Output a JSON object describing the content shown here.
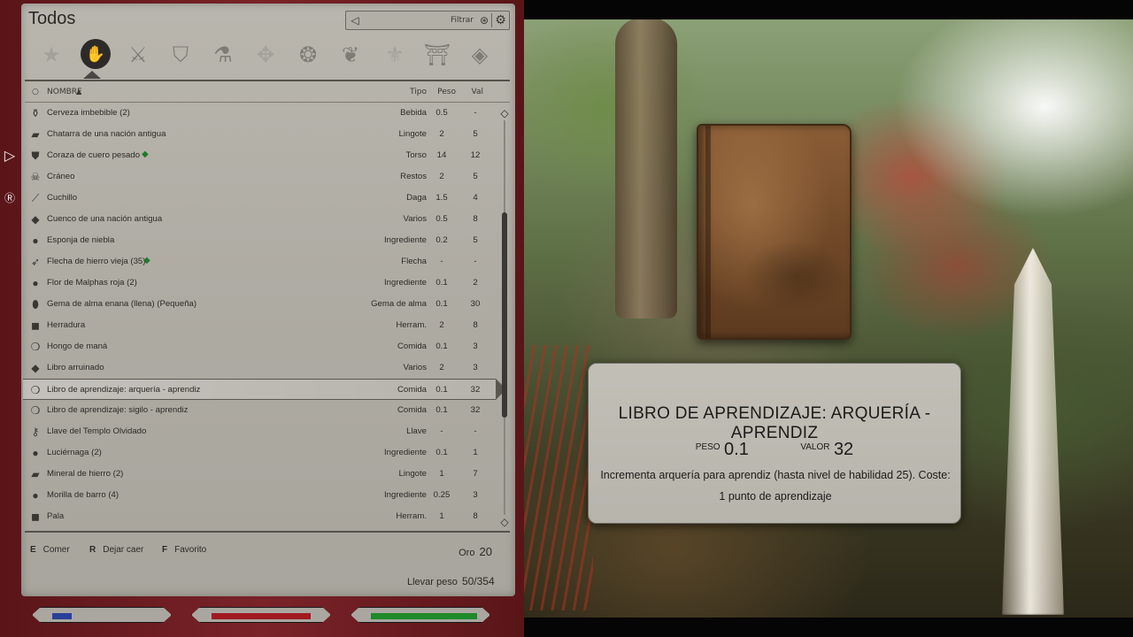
{
  "category": {
    "title": "Todos",
    "icons": [
      "star-icon",
      "all-items-icon",
      "weapons-icon",
      "armor-icon",
      "potions-icon",
      "scrolls-icon",
      "food-icon",
      "ingredients-icon",
      "books-icon",
      "keys-icon",
      "misc-icon"
    ],
    "active_index": 1
  },
  "filter": {
    "label": "Filtrar"
  },
  "columns": {
    "name": "NOMBRE",
    "type": "Tipo",
    "weight": "Peso",
    "value": "Val"
  },
  "items": [
    {
      "icon": "potion-icon",
      "name": "Cerveza imbebible (2)",
      "type": "Bebida",
      "weight": "0.5",
      "value": "-"
    },
    {
      "icon": "ingot-icon",
      "name": "Chatarra de una nación antigua",
      "type": "Lingote",
      "weight": "2",
      "value": "5"
    },
    {
      "icon": "armor-icon",
      "name": "Coraza de cuero pesado",
      "type": "Torso",
      "weight": "14",
      "value": "12",
      "favorite": true
    },
    {
      "icon": "skull-icon",
      "name": "Cráneo",
      "type": "Restos",
      "weight": "2",
      "value": "5"
    },
    {
      "icon": "dagger-icon",
      "name": "Cuchillo",
      "type": "Daga",
      "weight": "1.5",
      "value": "4"
    },
    {
      "icon": "misc-icon",
      "name": "Cuenco de una nación antigua",
      "type": "Varios",
      "weight": "0.5",
      "value": "8"
    },
    {
      "icon": "ingredient-icon",
      "name": "Esponja de niebla",
      "type": "Ingrediente",
      "weight": "0.2",
      "value": "5"
    },
    {
      "icon": "arrow-icon",
      "name": "Flecha de hierro vieja (35)",
      "type": "Flecha",
      "weight": "-",
      "value": "-",
      "favorite": true
    },
    {
      "icon": "ingredient-icon",
      "name": "Flor de Malphas roja (2)",
      "type": "Ingrediente",
      "weight": "0.1",
      "value": "2"
    },
    {
      "icon": "soulgem-icon",
      "name": "Gema de alma enana (llena) (Pequeña)",
      "type": "Gema de alma",
      "weight": "0.1",
      "value": "30"
    },
    {
      "icon": "tool-icon",
      "name": "Herradura",
      "type": "Herram.",
      "weight": "2",
      "value": "8"
    },
    {
      "icon": "food-icon",
      "name": "Hongo de maná",
      "type": "Comida",
      "weight": "0.1",
      "value": "3"
    },
    {
      "icon": "misc-icon",
      "name": "Libro arruinado",
      "type": "Varios",
      "weight": "2",
      "value": "3"
    },
    {
      "icon": "food-icon",
      "name": "Libro de aprendizaje: arquería - aprendiz",
      "type": "Comida",
      "weight": "0.1",
      "value": "32",
      "selected": true
    },
    {
      "icon": "food-icon",
      "name": "Libro de aprendizaje: sigilo - aprendiz",
      "type": "Comida",
      "weight": "0.1",
      "value": "32"
    },
    {
      "icon": "key-icon",
      "name": "Llave del Templo Olvidado",
      "type": "Llave",
      "weight": "-",
      "value": "-"
    },
    {
      "icon": "ingredient-icon",
      "name": "Luciérnaga (2)",
      "type": "Ingrediente",
      "weight": "0.1",
      "value": "1"
    },
    {
      "icon": "ingot-icon",
      "name": "Mineral de hierro (2)",
      "type": "Lingote",
      "weight": "1",
      "value": "7"
    },
    {
      "icon": "ingredient-icon",
      "name": "Morilla de barro (4)",
      "type": "Ingrediente",
      "weight": "0.25",
      "value": "3"
    },
    {
      "icon": "tool-icon",
      "name": "Pala",
      "type": "Herram.",
      "weight": "1",
      "value": "8"
    }
  ],
  "actions": [
    {
      "key": "E",
      "label": "Comer"
    },
    {
      "key": "R",
      "label": "Dejar caer"
    },
    {
      "key": "F",
      "label": "Favorito"
    }
  ],
  "gold": {
    "label": "Oro",
    "value": "20"
  },
  "carry": {
    "label": "Llevar peso",
    "value": "50/354"
  },
  "stats": {
    "magicka": {
      "fill": 0.2,
      "color": "#2a3f9a"
    },
    "health": {
      "fill": 1.0,
      "color": "#a11a22"
    },
    "stamina": {
      "fill": 1.0,
      "color": "#1f8a2c"
    }
  },
  "card": {
    "title": "LIBRO DE APRENDIZAJE: ARQUERÍA - APRENDIZ",
    "weight_label": "PESO",
    "weight_value": "0.1",
    "value_label": "VALOR",
    "value_value": "32",
    "description": "Incrementa arquería para aprendiz (hasta nivel de habilidad 25). Coste: 1 punto de aprendizaje"
  },
  "side_icons": [
    "left-tab-arrow-icon",
    "r-key-icon"
  ]
}
